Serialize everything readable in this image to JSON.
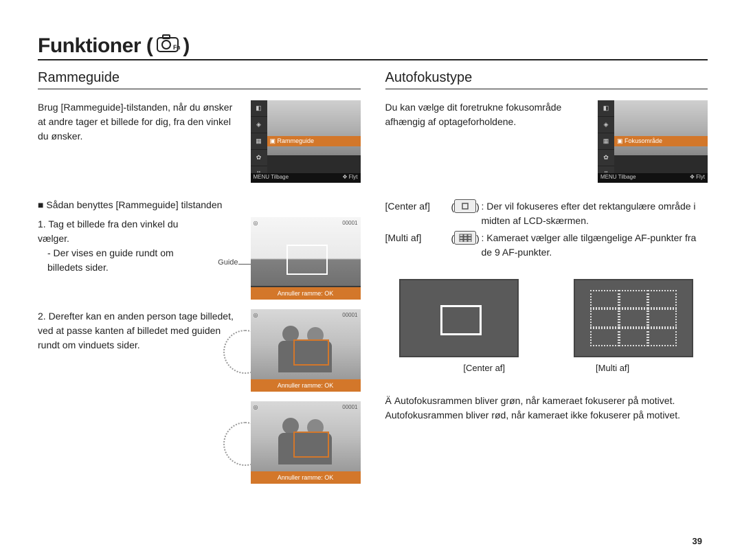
{
  "page": {
    "title": "Funktioner (",
    "title_close": ")",
    "number": "39"
  },
  "left": {
    "heading": "Rammeguide",
    "intro": "Brug [Rammeguide]-tilstanden, når du ønsker at andre tager et billede for dig, fra den vinkel du ønsker.",
    "subhead": "Sådan benyttes [Rammeguide] tilstanden",
    "step1_num": "1. Tag et billede fra den vinkel du vælger.",
    "step1_sub": "- Der vises en guide rundt om billedets sider.",
    "step2": "2. Derefter kan en anden person tage billedet, ved at passe kanten af billedet med guiden rundt om vinduets sider.",
    "guide_label": "Guide",
    "lcd_highlight": "Rammeguide",
    "lcd_back": "Tilbage",
    "lcd_move": "Flyt",
    "shot_bar": "Annuller ramme: OK",
    "shot_counter": "00001"
  },
  "right": {
    "heading": "Autofokustype",
    "intro": "Du kan vælge dit foretrukne fokusområde afhængig af optageforholdene.",
    "lcd_highlight": "Fokusområde",
    "lcd_back": "Tilbage",
    "lcd_move": "Flyt",
    "rows": [
      {
        "label": "[Center af]",
        "desc": "Der vil fokuseres efter det rektangulære område i midten af LCD-skærmen."
      },
      {
        "label": "[Multi af]",
        "desc": "Kameraet vælger alle tilgængelige AF-punkter fra de 9 AF-punkter."
      }
    ],
    "diagram_label_center": "[Center af]",
    "diagram_label_multi": "[Multi af]",
    "note_symbol": "Ä",
    "note": "Autofokusrammen bliver grøn, når kameraet fokuserer på motivet. Autofokusrammen bliver rød, når kameraet ikke fokuserer på motivet."
  }
}
